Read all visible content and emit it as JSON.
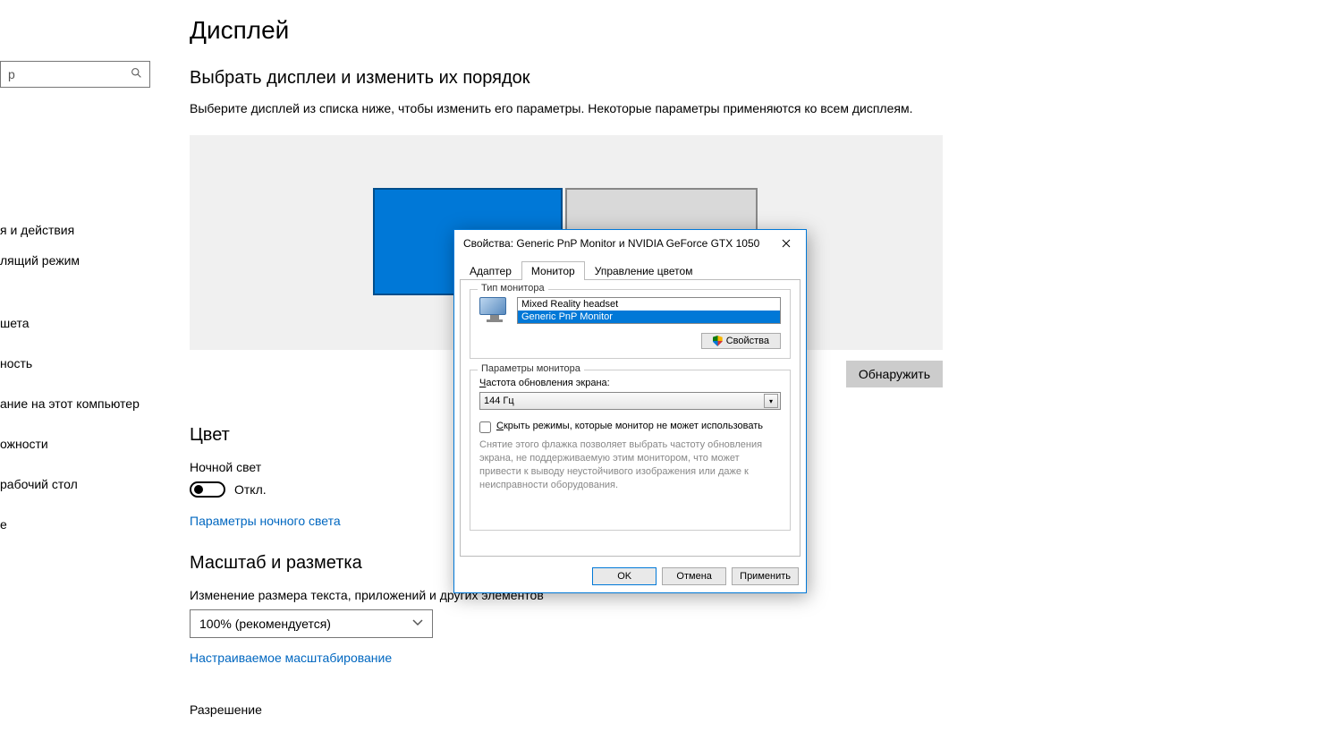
{
  "search": {
    "placeholder": "р"
  },
  "sidebar": {
    "items": [
      "я и действия",
      "лящий режим",
      "шета",
      "ность",
      "ание на этот компьютер",
      "ожности",
      "рабочий стол",
      "е"
    ]
  },
  "main": {
    "title": "Дисплей",
    "select_heading": "Выбрать дисплеи и изменить их порядок",
    "select_desc": "Выберите дисплей из списка ниже, чтобы изменить его параметры. Некоторые параметры применяются ко всем дисплеям.",
    "detect_button": "Обнаружить",
    "color_heading": "Цвет",
    "night_light_label": "Ночной свет",
    "night_light_state": "Откл.",
    "night_light_link": "Параметры ночного света",
    "scale_heading": "Масштаб и разметка",
    "scale_label": "Изменение размера текста, приложений и других элементов",
    "scale_value": "100% (рекомендуется)",
    "custom_scaling_link": "Настраиваемое масштабирование",
    "resolution_label": "Разрешение"
  },
  "dialog": {
    "title": "Свойства: Generic PnP Monitor и NVIDIA GeForce GTX 1050",
    "tabs": {
      "adapter": "Адаптер",
      "monitor": "Монитор",
      "color": "Управление цветом"
    },
    "group_monitor_type": "Тип монитора",
    "monitors": [
      {
        "name": "Mixed Reality headset",
        "selected": false
      },
      {
        "name": "Generic PnP Monitor",
        "selected": true
      }
    ],
    "properties_button": "Свойства",
    "group_monitor_settings": "Параметры монитора",
    "refresh_label": "Частота обновления экрана:",
    "refresh_value": "144 Гц",
    "hide_modes_label": "Скрыть режимы, которые монитор не может использовать",
    "hide_modes_help": "Снятие этого флажка позволяет выбрать частоту обновления экрана, не поддерживаемую этим монитором, что может привести к выводу неустойчивого изображения или даже к неисправности оборудования.",
    "ok": "OK",
    "cancel": "Отмена",
    "apply": "Применить"
  }
}
